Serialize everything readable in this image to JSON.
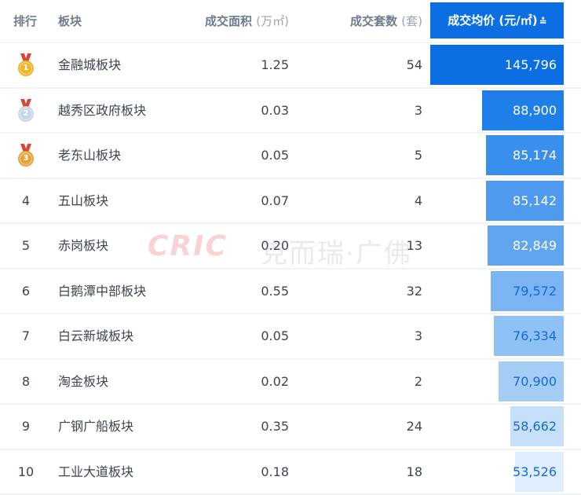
{
  "header": {
    "rank": "排行",
    "plate": "板块",
    "area_label": "成交面积",
    "area_unit": "(万㎡)",
    "sets_label": "成交套数",
    "sets_unit": "(套)",
    "price_label": "成交均价 (元/㎡)",
    "sort_icon": "sort-descending-icon"
  },
  "watermark": {
    "logo": "CRIC",
    "text": "克而瑞·广佛"
  },
  "rows": [
    {
      "rank": "1",
      "medal": "gold",
      "plate": "金融城板块",
      "area": "1.25",
      "sets": "54",
      "price": "145,796",
      "price_value": 145796
    },
    {
      "rank": "2",
      "medal": "silver",
      "plate": "越秀区政府板块",
      "area": "0.03",
      "sets": "3",
      "price": "88,900",
      "price_value": 88900
    },
    {
      "rank": "3",
      "medal": "bronze",
      "plate": "老东山板块",
      "area": "0.05",
      "sets": "5",
      "price": "85,174",
      "price_value": 85174
    },
    {
      "rank": "4",
      "medal": "",
      "plate": "五山板块",
      "area": "0.07",
      "sets": "4",
      "price": "85,142",
      "price_value": 85142
    },
    {
      "rank": "5",
      "medal": "",
      "plate": "赤岗板块",
      "area": "0.20",
      "sets": "13",
      "price": "82,849",
      "price_value": 82849
    },
    {
      "rank": "6",
      "medal": "",
      "plate": "白鹅潭中部板块",
      "area": "0.55",
      "sets": "32",
      "price": "79,572",
      "price_value": 79572
    },
    {
      "rank": "7",
      "medal": "",
      "plate": "白云新城板块",
      "area": "0.05",
      "sets": "3",
      "price": "76,334",
      "price_value": 76334
    },
    {
      "rank": "8",
      "medal": "",
      "plate": "淘金板块",
      "area": "0.02",
      "sets": "2",
      "price": "70,900",
      "price_value": 70900
    },
    {
      "rank": "9",
      "medal": "",
      "plate": "广钢广船板块",
      "area": "0.35",
      "sets": "24",
      "price": "58,662",
      "price_value": 58662
    },
    {
      "rank": "10",
      "medal": "",
      "plate": "工业大道板块",
      "area": "0.18",
      "sets": "18",
      "price": "53,526",
      "price_value": 53526
    }
  ],
  "colors": {
    "bars": [
      "#0b6fe3",
      "#1e7fe9",
      "#3b8fec",
      "#4f9aee",
      "#5fa5f0",
      "#7ab4f2",
      "#8ec1f4",
      "#a4cdf6",
      "#c6e0f9",
      "#dfeefc"
    ],
    "bar_text": [
      "#ffffff",
      "#ffffff",
      "#ffffff",
      "#ffffff",
      "#ffffff",
      "#1769d8",
      "#1769d8",
      "#1769d8",
      "#1769d8",
      "#1769d8"
    ],
    "medal_gold": "#f0b428",
    "medal_silver": "#c7d6e6",
    "medal_bronze": "#e8a23a",
    "ribbon": "#d6493a"
  }
}
